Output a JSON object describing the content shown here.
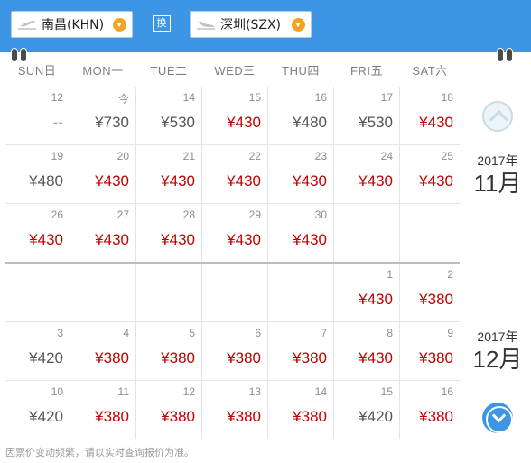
{
  "header": {
    "from_city": "南昌(KHN)",
    "to_city": "深圳(SZX)",
    "swap_label": "换"
  },
  "weekdays": [
    "SUN日",
    "MON一",
    "TUE二",
    "WED三",
    "THU四",
    "FRI五",
    "SAT六"
  ],
  "colors": {
    "header_bg": "#3d95e6",
    "low_price": "#c10000",
    "std_price": "#555555",
    "accent_orange": "#f3a423"
  },
  "months": [
    {
      "year": "2017年",
      "month": "11月"
    },
    {
      "year": "2017年",
      "month": "12月"
    }
  ],
  "rows": [
    [
      {
        "day": "12",
        "price": "--"
      },
      {
        "day": "今",
        "price": "¥730"
      },
      {
        "day": "14",
        "price": "¥530"
      },
      {
        "day": "15",
        "price": "¥430"
      },
      {
        "day": "16",
        "price": "¥480"
      },
      {
        "day": "17",
        "price": "¥530"
      },
      {
        "day": "18",
        "price": "¥430"
      }
    ],
    [
      {
        "day": "19",
        "price": "¥480"
      },
      {
        "day": "20",
        "price": "¥430"
      },
      {
        "day": "21",
        "price": "¥430"
      },
      {
        "day": "22",
        "price": "¥430"
      },
      {
        "day": "23",
        "price": "¥430"
      },
      {
        "day": "24",
        "price": "¥430"
      },
      {
        "day": "25",
        "price": "¥430"
      }
    ],
    [
      {
        "day": "26",
        "price": "¥430"
      },
      {
        "day": "27",
        "price": "¥430"
      },
      {
        "day": "28",
        "price": "¥430"
      },
      {
        "day": "29",
        "price": "¥430"
      },
      {
        "day": "30",
        "price": "¥430"
      },
      {
        "day": "",
        "price": ""
      },
      {
        "day": "",
        "price": ""
      }
    ],
    [
      {
        "day": "",
        "price": ""
      },
      {
        "day": "",
        "price": ""
      },
      {
        "day": "",
        "price": ""
      },
      {
        "day": "",
        "price": ""
      },
      {
        "day": "",
        "price": ""
      },
      {
        "day": "1",
        "price": "¥430"
      },
      {
        "day": "2",
        "price": "¥380"
      }
    ],
    [
      {
        "day": "3",
        "price": "¥420"
      },
      {
        "day": "4",
        "price": "¥380"
      },
      {
        "day": "5",
        "price": "¥380"
      },
      {
        "day": "6",
        "price": "¥380"
      },
      {
        "day": "7",
        "price": "¥380"
      },
      {
        "day": "8",
        "price": "¥430"
      },
      {
        "day": "9",
        "price": "¥380"
      }
    ],
    [
      {
        "day": "10",
        "price": "¥420"
      },
      {
        "day": "11",
        "price": "¥380"
      },
      {
        "day": "12",
        "price": "¥380"
      },
      {
        "day": "13",
        "price": "¥380"
      },
      {
        "day": "14",
        "price": "¥380"
      },
      {
        "day": "15",
        "price": "¥420"
      },
      {
        "day": "16",
        "price": "¥380"
      }
    ]
  ],
  "low_prices": [
    "¥430",
    "¥380"
  ],
  "disclaimer": "因票价变动频繁，请以实时查询报价为准。"
}
